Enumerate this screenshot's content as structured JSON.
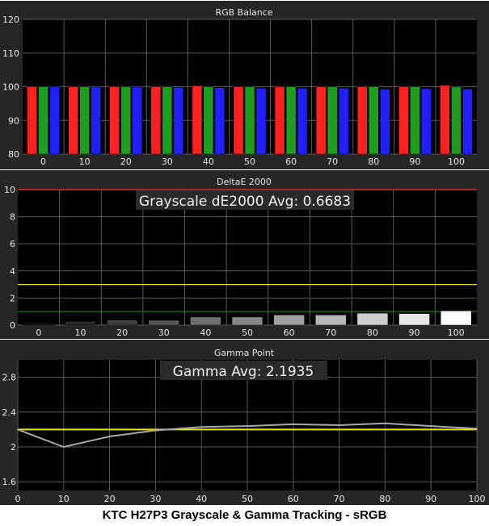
{
  "caption": "KTC H27P3 Grayscale & Gamma Tracking - sRGB",
  "colors": {
    "panel_bg": "#262626",
    "plot_bg": "#000000",
    "grid": "#5a5a5a",
    "text": "#e6e6e6",
    "red": "#ff2020",
    "green": "#1e9e1e",
    "blue": "#2020ff",
    "yellow": "#e6e600",
    "dark_green": "#1a7a1a",
    "limit_red": "#ff3030",
    "gamma_line": "#a8a8a8"
  },
  "chart_data": [
    {
      "type": "bar",
      "title": "RGB Balance",
      "categories": [
        "0",
        "10",
        "20",
        "30",
        "40",
        "50",
        "60",
        "70",
        "80",
        "90",
        "100"
      ],
      "series": [
        {
          "color": "red",
          "values": [
            100.0,
            100.0,
            100.0,
            100.0,
            100.3,
            100.0,
            100.0,
            100.0,
            100.0,
            100.0,
            100.4
          ]
        },
        {
          "color": "green",
          "values": [
            100.0,
            100.0,
            100.0,
            100.0,
            100.0,
            100.0,
            100.0,
            100.0,
            100.0,
            100.0,
            99.9
          ]
        },
        {
          "color": "blue",
          "values": [
            100.0,
            99.9,
            99.9,
            99.8,
            99.7,
            99.6,
            99.6,
            99.6,
            99.3,
            99.4,
            99.3
          ]
        }
      ],
      "ylim": [
        80,
        120
      ],
      "yticks": [
        "80",
        "90",
        "100",
        "110",
        "120"
      ],
      "grid": true
    },
    {
      "type": "bar",
      "title": "DeltaE 2000",
      "annotation": "Grayscale dE2000 Avg: 0.6683",
      "categories": [
        "0",
        "10",
        "20",
        "30",
        "40",
        "50",
        "60",
        "70",
        "80",
        "90",
        "100"
      ],
      "values": [
        0.2,
        0.28,
        0.38,
        0.36,
        0.6,
        0.6,
        0.75,
        0.75,
        0.88,
        0.85,
        1.05
      ],
      "ylim": [
        0,
        10
      ],
      "yticks": [
        "0",
        "2",
        "4",
        "6",
        "8",
        "10"
      ],
      "reference_lines": [
        10,
        3,
        1
      ],
      "grid": true
    },
    {
      "type": "line",
      "title": "Gamma Point",
      "annotation": "Gamma Avg: 2.1935",
      "x": [
        0,
        10,
        20,
        30,
        40,
        50,
        60,
        70,
        80,
        90,
        100
      ],
      "xticks": [
        "0",
        "10",
        "20",
        "30",
        "40",
        "50",
        "60",
        "70",
        "80",
        "90",
        "100"
      ],
      "y": [
        2.2,
        2.0,
        2.12,
        2.19,
        2.23,
        2.24,
        2.26,
        2.25,
        2.27,
        2.24,
        2.21
      ],
      "target": 2.2,
      "ylim": [
        1.5,
        3.0
      ],
      "yticks": [
        "1.6",
        "2",
        "2.4",
        "2.8"
      ],
      "grid": true
    }
  ]
}
